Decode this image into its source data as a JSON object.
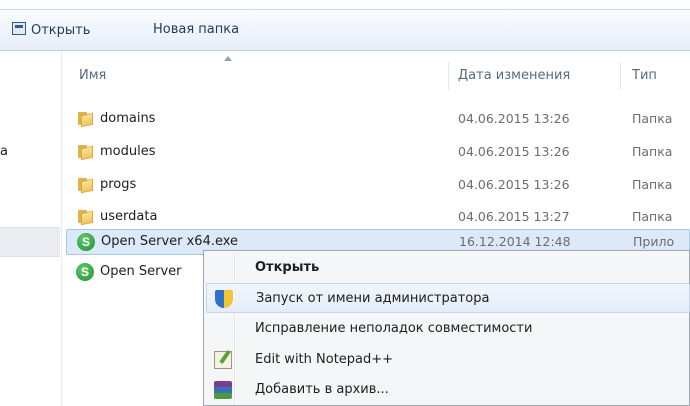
{
  "toolbar": {
    "open_label": "Открыть",
    "new_folder_label": "Новая папка"
  },
  "left_pane": {
    "partial_label": "а"
  },
  "columns": {
    "name": "Имя",
    "date": "Дата изменения",
    "type": "Тип"
  },
  "files": [
    {
      "name": "domains",
      "date": "04.06.2015 13:26",
      "type": "Папка",
      "icon": "folder-icon"
    },
    {
      "name": "modules",
      "date": "04.06.2015 13:26",
      "type": "Папка",
      "icon": "folder-icon"
    },
    {
      "name": "progs",
      "date": "04.06.2015 13:26",
      "type": "Папка",
      "icon": "folder-icon"
    },
    {
      "name": "userdata",
      "date": "04.06.2015 13:27",
      "type": "Папка",
      "icon": "folder-icon"
    },
    {
      "name": "Open Server x64.exe",
      "date": "16.12.2014 12:48",
      "type": "Прило",
      "icon": "open-server-icon",
      "selected": true
    },
    {
      "name": "Open Server",
      "date": "",
      "type": "",
      "icon": "open-server-icon"
    }
  ],
  "context_menu": {
    "items": [
      {
        "label": "Открыть",
        "bold": true,
        "icon": ""
      },
      {
        "label": "Запуск от имени администратора",
        "icon": "uac-shield-icon",
        "hover": true
      },
      {
        "label": "Исправление неполадок совместимости",
        "icon": ""
      },
      {
        "label": "Edit with Notepad++",
        "icon": "notepad-plus-plus-icon"
      },
      {
        "label": "Добавить в архив...",
        "icon": "winrar-archive-icon"
      }
    ]
  },
  "colors": {
    "selection": "#dbe9f8",
    "toolbar": "#e6eef8"
  }
}
